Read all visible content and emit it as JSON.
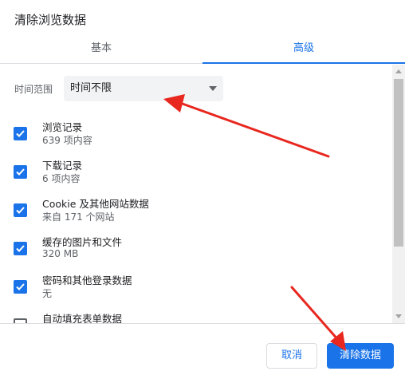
{
  "dialog": {
    "title": "清除浏览数据"
  },
  "tabs": [
    {
      "label": "基本",
      "active": false
    },
    {
      "label": "高级",
      "active": true
    }
  ],
  "time_range": {
    "label": "时间范围",
    "value": "时间不限"
  },
  "items": [
    {
      "title": "浏览记录",
      "subtitle": "639 项内容",
      "checked": true
    },
    {
      "title": "下载记录",
      "subtitle": "6 项内容",
      "checked": true
    },
    {
      "title": "Cookie 及其他网站数据",
      "subtitle": "来自 171 个网站",
      "checked": true
    },
    {
      "title": "缓存的图片和文件",
      "subtitle": "320 MB",
      "checked": true
    },
    {
      "title": "密码和其他登录数据",
      "subtitle": "无",
      "checked": true
    },
    {
      "title": "自动填充表单数据",
      "subtitle": "",
      "checked": false
    }
  ],
  "footer": {
    "cancel_label": "取消",
    "clear_label": "清除数据"
  },
  "colors": {
    "accent": "#1a73e8",
    "annotation_arrow": "#e8271f"
  },
  "icons": {
    "checkbox_check": "checkmark-icon",
    "dropdown": "caret-down-icon"
  }
}
